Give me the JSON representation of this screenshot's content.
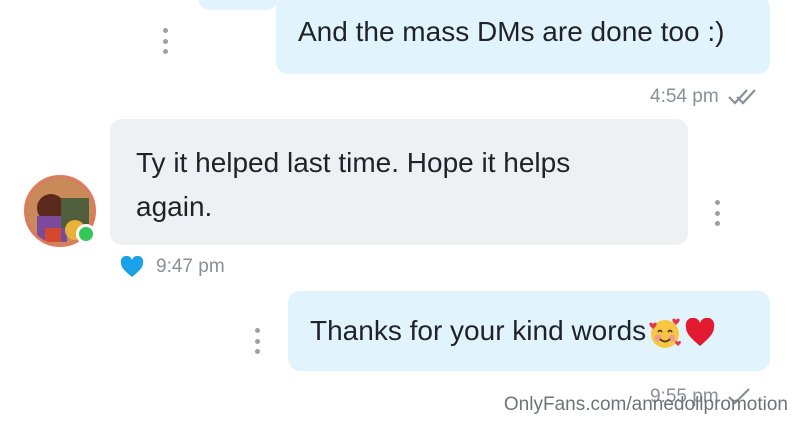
{
  "messages": [
    {
      "direction": "outgoing",
      "text": "And the mass DMs are done too :)",
      "time": "4:54 pm",
      "status_icon": "double-check-icon"
    },
    {
      "direction": "incoming",
      "text_line1": "Ty it helped last time. Hope it helps",
      "text_line2": "again.",
      "time": "9:47 pm",
      "reaction_icon": "blue-heart-icon"
    },
    {
      "direction": "outgoing",
      "text": "Thanks for your kind words",
      "emojis": [
        "smiling-face-with-hearts-icon",
        "red-heart-icon"
      ],
      "time": "9:55 pm",
      "status_icon": "check-icon"
    }
  ],
  "watermark": "OnlyFans.com/annedollpromotion",
  "colors": {
    "outgoing_bubble": "#e1f3fd",
    "incoming_bubble": "#eef0f3",
    "meta_text": "#8a9099",
    "reaction_heart": "#1aa1e8",
    "online_dot": "#34c759"
  }
}
